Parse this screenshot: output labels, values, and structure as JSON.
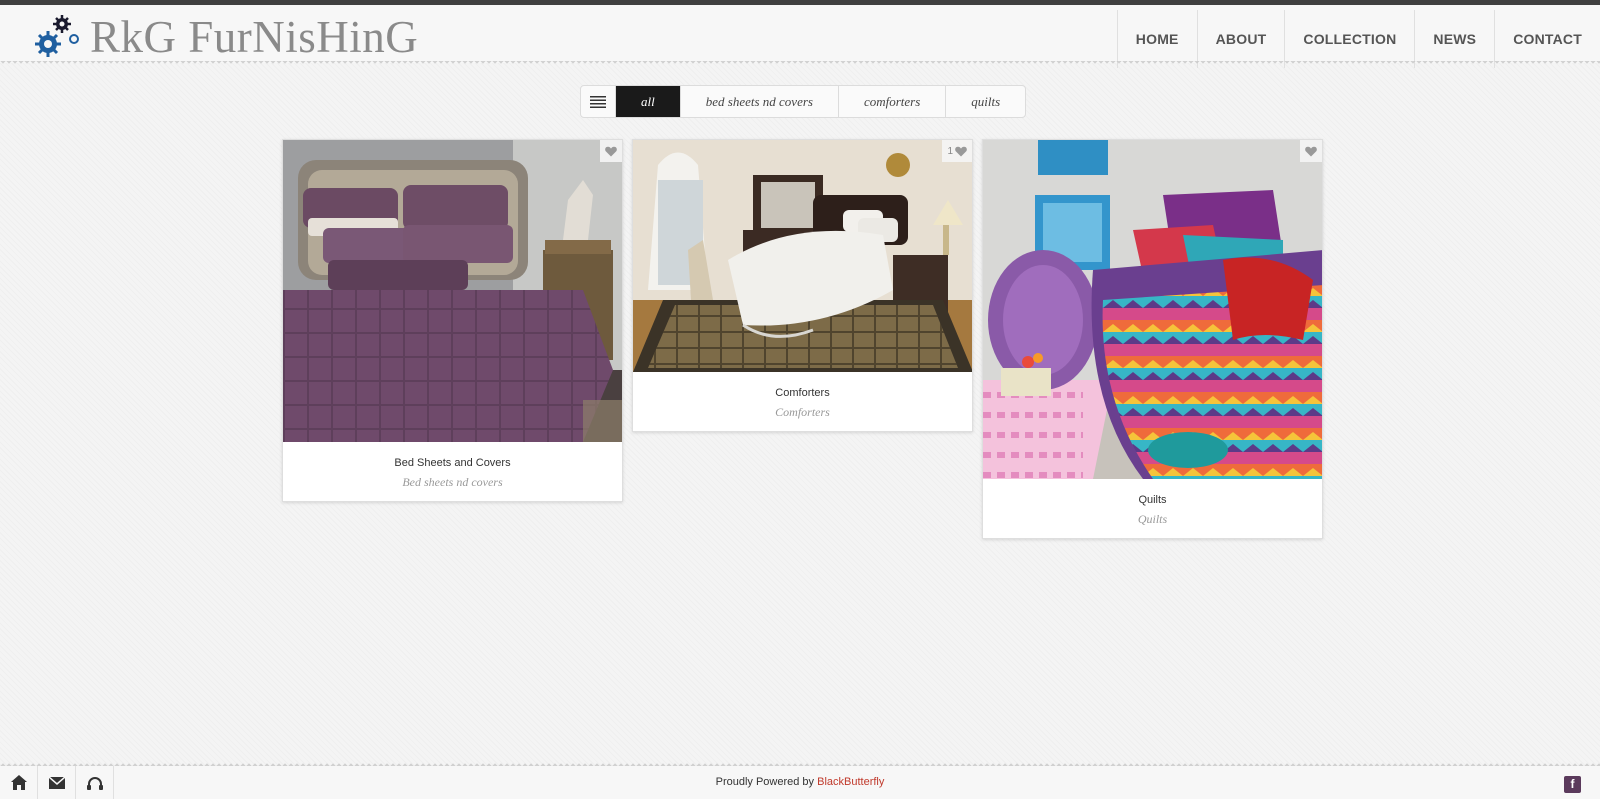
{
  "logo": {
    "text": "RkG FurNisHinG"
  },
  "nav": {
    "items": [
      "HOME",
      "ABOUT",
      "COLLECTION",
      "NEWS",
      "CONTACT"
    ]
  },
  "filter": {
    "items": [
      "all",
      "bed sheets nd covers",
      "comforters",
      "quilts"
    ],
    "active": "all"
  },
  "cards": [
    {
      "title": "Bed Sheets and Covers",
      "subtitle": "Bed sheets nd covers",
      "likes": ""
    },
    {
      "title": "Comforters",
      "subtitle": "Comforters",
      "likes": "1"
    },
    {
      "title": "Quilts",
      "subtitle": "Quilts",
      "likes": ""
    }
  ],
  "footer": {
    "powered_prefix": "Proudly Powered by",
    "brand": "BlackButterfly",
    "fb_icon": "f"
  },
  "icons": [
    "gear-logo-icon",
    "menu-icon",
    "heart-icon",
    "home-icon",
    "mail-icon",
    "headphones-icon",
    "facebook-icon"
  ],
  "colors": {
    "accent": "#c0392b",
    "active_filter_bg": "#1a1a1a",
    "header_text": "#8a8a8a"
  }
}
